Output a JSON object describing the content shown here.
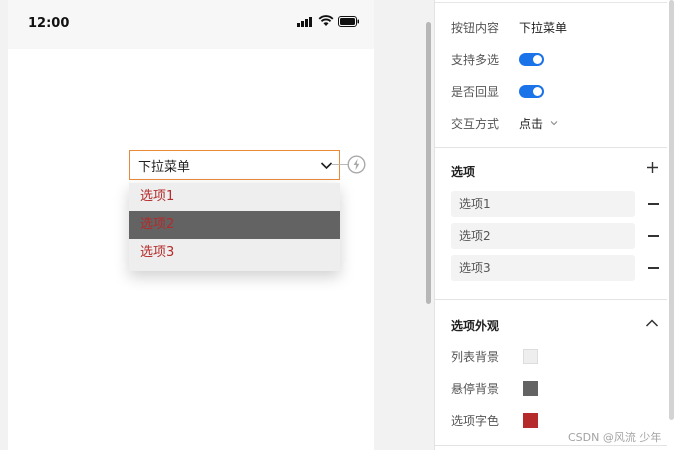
{
  "status_bar": {
    "time": "12:00"
  },
  "dropdown": {
    "trigger_label": "下拉菜单",
    "options": [
      "选项1",
      "选项2",
      "选项3"
    ],
    "hovered_index": 1
  },
  "panel": {
    "button_content": {
      "label": "按钮内容",
      "value": "下拉菜单"
    },
    "multi_select": {
      "label": "支持多选",
      "on": true
    },
    "echo": {
      "label": "是否回显",
      "on": true
    },
    "interaction": {
      "label": "交互方式",
      "value": "点击"
    },
    "options_section": {
      "title": "选项",
      "items": [
        "选项1",
        "选项2",
        "选项3"
      ]
    },
    "appearance_section": {
      "title": "选项外观",
      "list_bg": {
        "label": "列表背景",
        "color": "#eeeeee"
      },
      "hover_bg": {
        "label": "悬停背景",
        "color": "#636363"
      },
      "font_color": {
        "label": "选项字色",
        "color": "#b52a2a"
      }
    }
  },
  "watermark": "CSDN @风流 少年",
  "colors": {
    "accent": "#1a73e8",
    "trigger_border": "#e88a3a"
  }
}
